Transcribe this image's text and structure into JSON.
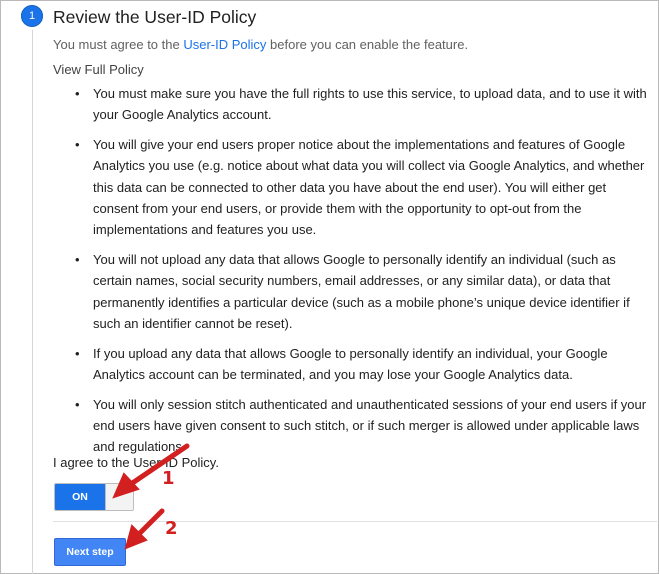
{
  "step": {
    "number": "1",
    "title": "Review the User-ID Policy",
    "subtitle_prefix": "You must agree to the ",
    "subtitle_link": "User-ID Policy",
    "subtitle_suffix": " before you can enable the feature."
  },
  "view_full_policy": "View Full Policy",
  "policy_items": [
    "You must make sure you have the full rights to use this service, to upload data, and to use it with your Google Analytics account.",
    "You will give your end users proper notice about the implementations and features of Google Analytics you use (e.g. notice about what data you will collect via Google Analytics, and whether this data can be connected to other data you have about the end user). You will either get consent from your end users, or provide them with the opportunity to opt-out from the implementations and features you use.",
    "You will not upload any data that allows Google to personally identify an individual (such as certain names, social security numbers, email addresses, or any similar data), or data that permanently identifies a particular device (such as a mobile phone’s unique device identifier if such an identifier cannot be reset).",
    "If you upload any data that allows Google to personally identify an individual, your Google Analytics account can be terminated, and you may lose your Google Analytics data.",
    "You will only session stitch authenticated and unauthenticated sessions of your end users if your end users have given consent to such stitch, or if such merger is allowed under applicable laws and regulations."
  ],
  "agree_label": "I agree to the User-ID Policy.",
  "toggle": {
    "label": "ON",
    "state": "on"
  },
  "next_button": "Next step",
  "annotations": {
    "marker_1": "1",
    "marker_2": "2"
  },
  "colors": {
    "accent": "#1a73e8",
    "button": "#4285f4",
    "annotation": "#d21f1f"
  }
}
